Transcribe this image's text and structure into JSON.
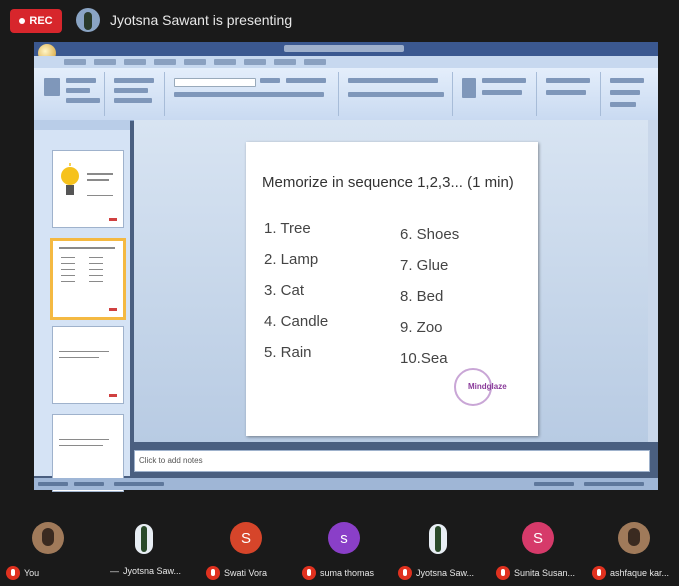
{
  "topbar": {
    "rec_label": "REC",
    "presenting_text": "Jyotsna Sawant is presenting"
  },
  "presentation": {
    "notes_placeholder": "Click to add notes",
    "slide": {
      "title": "Memorize in sequence 1,2,3... (1 min)",
      "items": [
        "1. Tree",
        "2. Lamp",
        "3. Cat",
        "4. Candle",
        "5. Rain",
        "6. Shoes",
        "7. Glue",
        "8. Bed",
        "9. Zoo",
        "10.Sea"
      ],
      "logo_text": "Mindglaze"
    }
  },
  "participants": [
    {
      "name": "You",
      "avatar": "photo",
      "color": "#a07a5a"
    },
    {
      "name": "Jyotsna Saw...",
      "avatar": "figure",
      "color": "#2a4a2a",
      "pinned": true
    },
    {
      "name": "Swati Vora",
      "avatar": "S",
      "color": "#d6452a"
    },
    {
      "name": "suma thomas",
      "avatar": "s",
      "color": "#8a3fc8"
    },
    {
      "name": "Jyotsna Saw...",
      "avatar": "figure",
      "color": "#2a4a2a"
    },
    {
      "name": "Sunita Susan...",
      "avatar": "S",
      "color": "#d63a6a"
    },
    {
      "name": "ashfaque kar...",
      "avatar": "photo",
      "color": "#a07a5a"
    }
  ],
  "colors": {
    "rec": "#d7262c",
    "mic_muted": "#e0311f",
    "selected_thumb": "#f4b942"
  }
}
